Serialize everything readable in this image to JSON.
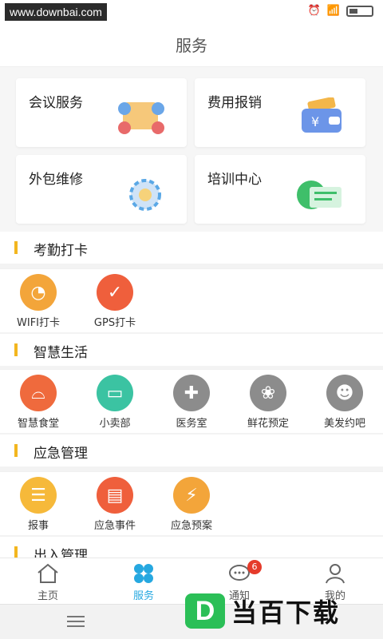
{
  "status": {
    "url_watermark": "www.downbai.com",
    "alarm_icon": "alarm-icon",
    "wifi_icon": "wifi-icon",
    "battery_icon": "battery-icon"
  },
  "header": {
    "title": "服务"
  },
  "cards": [
    {
      "label": "会议服务",
      "icon": "handshake-icon"
    },
    {
      "label": "费用报销",
      "icon": "wallet-icon"
    },
    {
      "label": "外包维修",
      "icon": "gear-icon"
    },
    {
      "label": "培训中心",
      "icon": "training-icon"
    }
  ],
  "sections": {
    "attendance": {
      "title": "考勤打卡",
      "items": [
        {
          "label": "WIFI打卡",
          "icon": "wifi-clock-icon",
          "color": "#f3a53a"
        },
        {
          "label": "GPS打卡",
          "icon": "gps-check-icon",
          "color": "#ef5f3c"
        }
      ]
    },
    "life": {
      "title": "智慧生活",
      "items": [
        {
          "label": "智慧食堂",
          "icon": "canteen-icon",
          "color": "#ef6a3d"
        },
        {
          "label": "小卖部",
          "icon": "shop-icon",
          "color": "#3bc3a2"
        },
        {
          "label": "医务室",
          "icon": "medical-icon",
          "color": "#8c8c8c"
        },
        {
          "label": "鲜花预定",
          "icon": "flower-icon",
          "color": "#8c8c8c"
        },
        {
          "label": "美发约吧",
          "icon": "hair-icon",
          "color": "#8c8c8c"
        }
      ]
    },
    "emergency": {
      "title": "应急管理",
      "items": [
        {
          "label": "报事",
          "icon": "report-icon",
          "color": "#f6b93a"
        },
        {
          "label": "应急事件",
          "icon": "event-icon",
          "color": "#ef5f3c"
        },
        {
          "label": "应急预案",
          "icon": "plan-icon",
          "color": "#f3a53a"
        }
      ]
    },
    "access": {
      "title": "出入管理"
    }
  },
  "tabbar": [
    {
      "label": "主页",
      "icon": "home-icon",
      "active": false
    },
    {
      "label": "服务",
      "icon": "grid-icon",
      "active": true
    },
    {
      "label": "通知",
      "icon": "chat-icon",
      "badge": "6",
      "active": false
    },
    {
      "label": "我的",
      "icon": "person-icon",
      "active": false
    }
  ],
  "watermark": {
    "logo_letter": "D",
    "logo_text": "当百下载"
  }
}
